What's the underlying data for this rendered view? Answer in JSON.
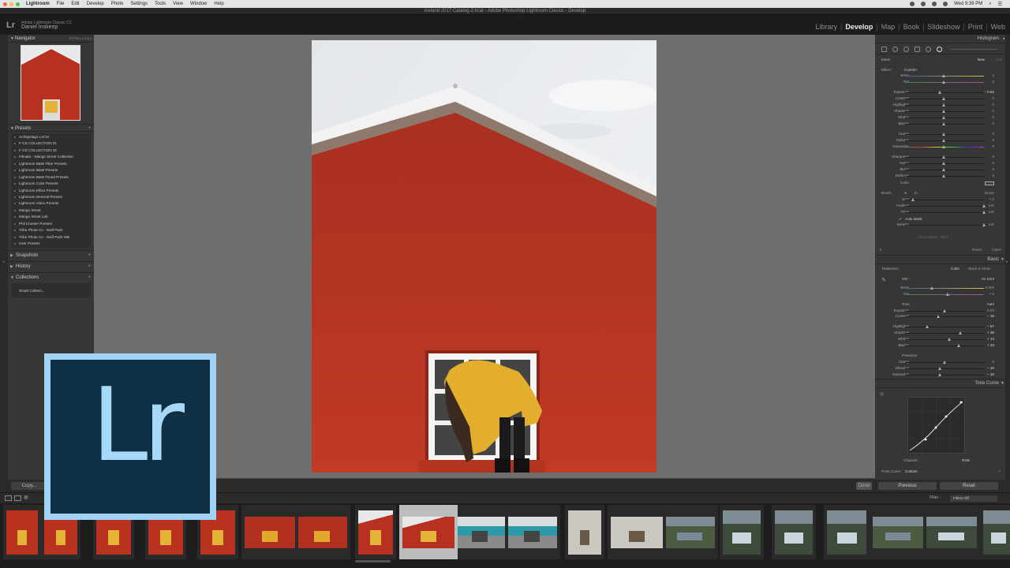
{
  "menubar": {
    "app": "Lightroom",
    "items": [
      "File",
      "Edit",
      "Develop",
      "Photo",
      "Settings",
      "Tools",
      "View",
      "Window",
      "Help"
    ],
    "clock": "Wed 9:39 PM"
  },
  "window_title": "Iceland 2017 Catalog-2.lrcat - Adobe Photoshop Lightroom Classic - Develop",
  "identity": {
    "product": "Adobe Lightroom Classic CC",
    "user": "Daniel Inskeep"
  },
  "modules": [
    "Library",
    "Develop",
    "Map",
    "Book",
    "Slideshow",
    "Print",
    "Web"
  ],
  "active_module": "Develop",
  "left_panel": {
    "navigator": "Navigator",
    "nav_options": "FIT  FILL  1:1  3:1",
    "presets_title": "Presets",
    "presets": [
      "Archipelago LXCN",
      "F-CD COLLECTION 01",
      "F-CD COLLECTION 02",
      "Filmatic - Mango Street Collection",
      "Lightroom B&W Filter Presets",
      "Lightroom B&W Presets",
      "Lightroom B&W Toned Presets",
      "Lightroom Color Presets",
      "Lightroom Effect Presets",
      "Lightroom General Presets",
      "Lightroom Video Presets",
      "Mango Street",
      "Mango Street Lab",
      "Phil Chester Presets",
      "Tribe Photo Co - Wolf Pack",
      "Tribe Photo Co - Wolf Pack WB",
      "User Presets"
    ],
    "snapshots": "Snapshots",
    "history": "History",
    "collections": "Collections",
    "smart_collection": "Smart Collecti...",
    "copy_button": "Copy..."
  },
  "right_panel": {
    "histogram": "Histogram",
    "mask_label": "Mask :",
    "mask_new": "New",
    "mask_edit": "Edit",
    "effect_label": "Effect :",
    "effect_value": "Custom",
    "mask_rows": [
      {
        "label": "Temp",
        "value": "0"
      },
      {
        "label": "Tint",
        "value": "0"
      },
      {
        "label": "Exposure",
        "value": "– 0.52"
      },
      {
        "label": "Contrast",
        "value": "0"
      },
      {
        "label": "Highlights",
        "value": "0"
      },
      {
        "label": "Shadows",
        "value": "0"
      },
      {
        "label": "Whites",
        "value": "0"
      },
      {
        "label": "Blacks",
        "value": "0"
      },
      {
        "label": "Clarity",
        "value": "0"
      },
      {
        "label": "Dehaze",
        "value": "0"
      },
      {
        "label": "Saturation",
        "value": "0"
      },
      {
        "label": "Sharpness",
        "value": "0"
      },
      {
        "label": "Noise",
        "value": "0"
      },
      {
        "label": "Moiré",
        "value": "0"
      },
      {
        "label": "Defringe",
        "value": "0"
      }
    ],
    "color_label": "Color",
    "brush_label": "Brush :",
    "brush_a": "A",
    "brush_b": "B",
    "erase": "Erase",
    "brush_rows": [
      {
        "label": "Size",
        "value": "7.0"
      },
      {
        "label": "Feather",
        "value": "100"
      },
      {
        "label": "Flow",
        "value": "100"
      }
    ],
    "auto_mask": "Auto Mask",
    "density_label": "Density",
    "density_value": "100",
    "show_mask": "Show Mask : Off ♦",
    "reset": "Reset",
    "close": "Close",
    "basic": "Basic",
    "treatment_label": "Treatment :",
    "treatment_color": "Color",
    "treatment_bw": "Black & White",
    "wb_label": "WB :",
    "wb_value": "As Shot",
    "temp_label": "Temp",
    "temp_value": "5,800",
    "tint_label": "Tint",
    "tint_value": "+ 6",
    "tone_label": "Tone",
    "tone_auto": "Auto",
    "basic_exposure_label": "Exposure",
    "basic_exposure_value": "0.00",
    "basic_contrast_label": "Contrast",
    "basic_contrast_value": "– 16",
    "tone_rows": [
      {
        "label": "Highlights",
        "value": "– 57"
      },
      {
        "label": "Shadows",
        "value": "+ 39"
      },
      {
        "label": "Whites",
        "value": "+ 14"
      },
      {
        "label": "Blacks",
        "value": "+ 33"
      }
    ],
    "presence_label": "Presence",
    "presence_rows": [
      {
        "label": "Clarity",
        "value": "0"
      },
      {
        "label": "Vibrance",
        "value": "– 10"
      },
      {
        "label": "Saturation",
        "value": "– 10"
      }
    ],
    "tone_curve": "Tone Curve",
    "channel_label": "Channel :",
    "channel_value": "RGB",
    "point_curve_label": "Point Curve :",
    "point_curve_value": "Custom",
    "previous": "Previous",
    "reset_btn": "Reset"
  },
  "toolbar": {
    "done": "Done"
  },
  "filmstrip": {
    "filter_label": "Filter :",
    "filter_value": "Filters Off"
  },
  "logo": {
    "text": "Lr",
    "bg_color": "#0f2f45",
    "accent_color": "#9fd2f3"
  }
}
